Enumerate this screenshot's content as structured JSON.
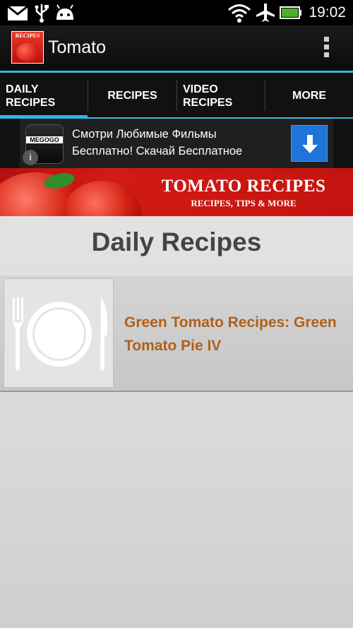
{
  "status_bar": {
    "time": "19:02",
    "icons": [
      "gmail-icon",
      "usb-icon",
      "android-icon",
      "wifi-icon",
      "airplane-icon",
      "battery-icon"
    ]
  },
  "action_bar": {
    "app_icon_label": "RECIPES",
    "title": "Tomato",
    "overflow_icon": "overflow-menu-icon"
  },
  "tabs": [
    {
      "label": "DAILY\nRECIPES",
      "active": true
    },
    {
      "label": "RECIPES",
      "active": false
    },
    {
      "label": "VIDEO\nRECIPES",
      "active": false
    },
    {
      "label": "MORE",
      "active": false
    }
  ],
  "ad": {
    "logo_text": "MEGOGO",
    "info_icon": "info-icon",
    "text_line1": "Смотри Любимые Фильмы",
    "text_line2": "Бесплатно! Скачай Бесплатное",
    "download_icon": "download-arrow-icon"
  },
  "hero": {
    "title": "TOMATO RECIPES",
    "subtitle": "RECIPES, TIPS & MORE"
  },
  "main": {
    "section_title": "Daily Recipes",
    "items": [
      {
        "title": "Green Tomato Recipes: Green Tomato Pie IV",
        "thumb_icon": "plate-cutlery-icon"
      }
    ]
  },
  "colors": {
    "accent": "#33b5e5",
    "recipe_title": "#b1601b",
    "hero_bg": "#c4140f",
    "download_button": "#1f73d9"
  }
}
